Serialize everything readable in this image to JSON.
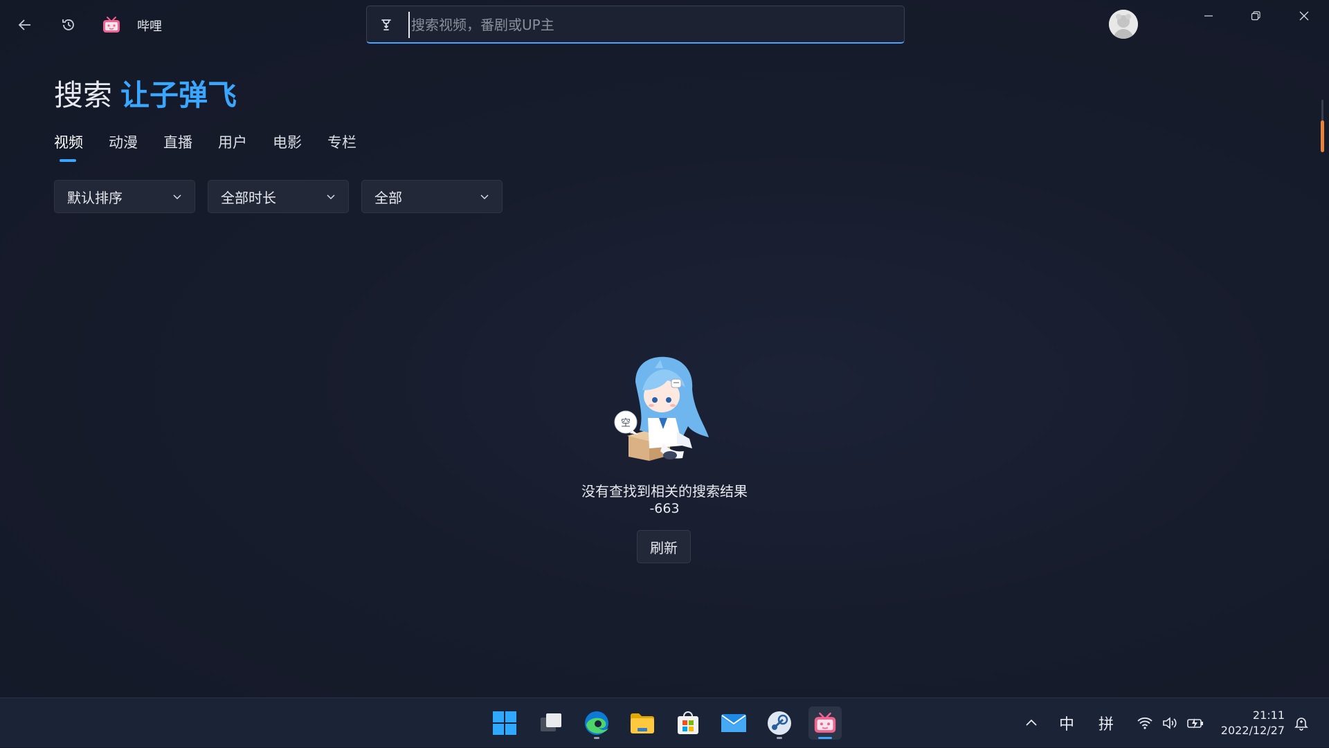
{
  "app": {
    "name": "哔哩"
  },
  "search": {
    "placeholder": "搜索视频，番剧或UP主",
    "value": ""
  },
  "page": {
    "title_label": "搜索",
    "keyword": "让子弹飞"
  },
  "tabs": [
    {
      "label": "视频",
      "active": true
    },
    {
      "label": "动漫",
      "active": false
    },
    {
      "label": "直播",
      "active": false
    },
    {
      "label": "用户",
      "active": false
    },
    {
      "label": "电影",
      "active": false
    },
    {
      "label": "专栏",
      "active": false
    }
  ],
  "filters": {
    "sort": "默认排序",
    "duration": "全部时长",
    "zone": "全部"
  },
  "empty_state": {
    "message": "没有查找到相关的搜索结果",
    "code": "-663",
    "refresh_label": "刷新",
    "bubble_text": "空"
  },
  "taskbar": {
    "ime_lang": "中",
    "ime_mode": "拼",
    "time": "21:11",
    "date": "2022/12/27"
  },
  "colors": {
    "accent": "#3aa7ff",
    "background": "#171c2c",
    "brand_pink": "#f06292"
  }
}
